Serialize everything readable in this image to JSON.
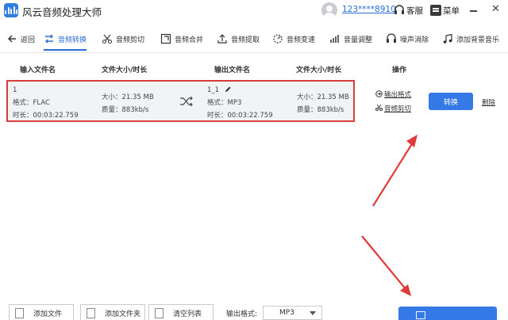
{
  "titlebar": {
    "app_title": "风云音频处理大师",
    "user_id": "123****8910",
    "customer_service_label": "客服",
    "menu_label": "菜单"
  },
  "toolbar": {
    "back_label": "返回",
    "tools": [
      {
        "label": "音频转换",
        "icon": "convert-icon",
        "active": true
      },
      {
        "label": "音频剪切",
        "icon": "scissors-icon"
      },
      {
        "label": "音频合并",
        "icon": "merge-icon"
      },
      {
        "label": "音频提取",
        "icon": "extract-icon"
      },
      {
        "label": "音频变速",
        "icon": "speed-icon"
      },
      {
        "label": "音量调整",
        "icon": "volume-icon"
      },
      {
        "label": "噪声消除",
        "icon": "noise-icon"
      },
      {
        "label": "添加背景音乐",
        "icon": "music-icon"
      }
    ]
  },
  "table": {
    "headers": {
      "input_file": "输入文件名",
      "input_size": "文件大小/时长",
      "output_file": "输出文件名",
      "output_size": "文件大小/时长",
      "actions": "操作"
    },
    "row": {
      "input_name": "1",
      "input_format": "格式：FLAC",
      "input_duration": "时长：00:03:22.759",
      "input_size": "大小：21.35 MB",
      "input_quality": "质量：883kb/s",
      "output_name": "1_1",
      "output_format": "格式：MP3",
      "output_duration": "时长：00:03:22.759",
      "output_size": "大小：21.35 MB",
      "output_quality": "质量：883kb/s",
      "output_format_link": "输出格式",
      "audio_cut_link": "音频剪切",
      "convert_label": "转换",
      "delete_label": "删除"
    }
  },
  "bottom": {
    "add_file": "添加文件",
    "add_folder": "添加文件夹",
    "clear_list": "清空列表",
    "output_format_label": "输出格式:",
    "output_format_value": "MP3"
  },
  "colors": {
    "accent": "#3579e6",
    "highlight_border": "#d93a3a",
    "arrow": "#e03a3a"
  }
}
